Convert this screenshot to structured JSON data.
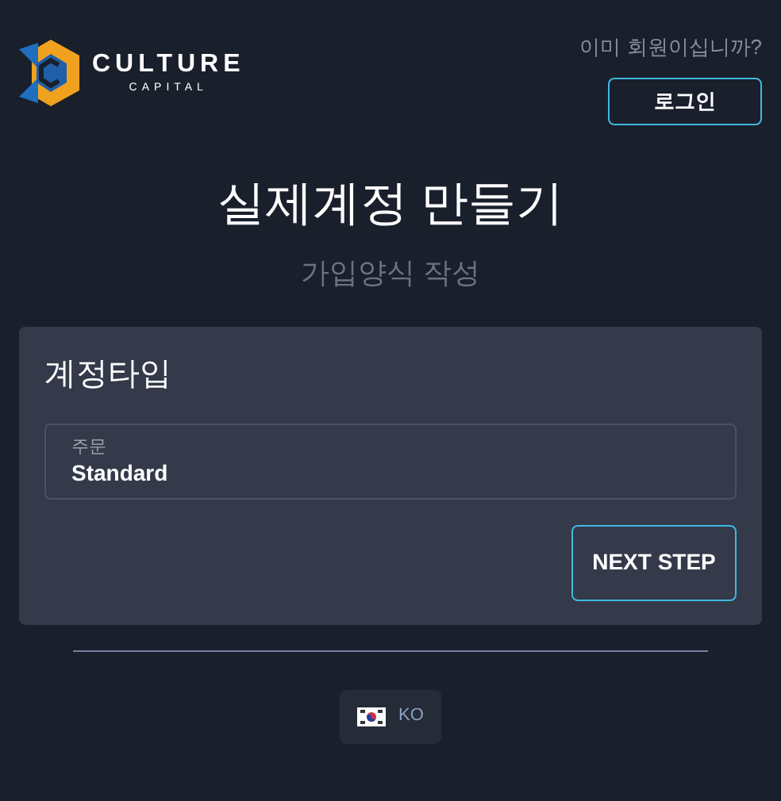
{
  "logo": {
    "name": "CULTURE",
    "tagline": "CAPITAL"
  },
  "header": {
    "prompt": "이미 회원이십니까?",
    "login_button": "로그인"
  },
  "title": "실제계정 만들기",
  "subtitle": "가입양식 작성",
  "card": {
    "title": "계정타입",
    "field": {
      "label": "주문",
      "value": "Standard"
    },
    "next_button": "NEXT STEP"
  },
  "language": {
    "code": "KO"
  }
}
